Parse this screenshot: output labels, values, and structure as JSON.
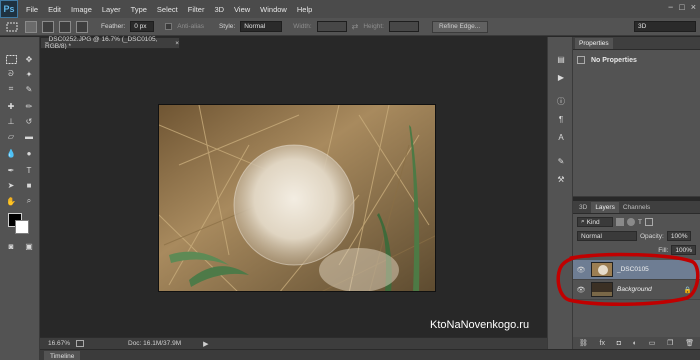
{
  "app": {
    "logo": "Ps"
  },
  "menu": [
    "File",
    "Edit",
    "Image",
    "Layer",
    "Type",
    "Select",
    "Filter",
    "3D",
    "View",
    "Window",
    "Help"
  ],
  "window_controls": [
    "−",
    "□",
    "×"
  ],
  "options": {
    "feather_label": "Feather:",
    "feather_value": "0 px",
    "antialias_label": "Anti-alias",
    "style_label": "Style:",
    "style_value": "Normal",
    "width_label": "Width:",
    "height_label": "Height:",
    "refine_edge": "Refine Edge...",
    "workspace": "3D"
  },
  "document": {
    "tab_title": "_DSC0252.JPG @ 16.7% (_DSC0105, RGB/8) *",
    "zoom": "16.67%",
    "doc_size": "Doc: 16.1M/37.9M"
  },
  "timeline": {
    "label": "Timeline"
  },
  "properties": {
    "tab": "Properties",
    "body": "No Properties"
  },
  "layers_panel": {
    "tabs": [
      "3D",
      "Layers",
      "Channels"
    ],
    "active_tab": "Layers",
    "kind": "Kind",
    "blend_mode": "Normal",
    "opacity_label": "Opacity:",
    "opacity_value": "100%",
    "fill_label": "Fill:",
    "fill_value": "100%",
    "layers": [
      {
        "name": "_DSC0105",
        "selected": true
      },
      {
        "name": "Background",
        "selected": false,
        "locked": true
      }
    ]
  },
  "watermark": "KtoNaNovenkogo.ru",
  "colors": {
    "menubar": "#4b4b4b",
    "panel": "#535353",
    "canvas_bg": "#282828",
    "selection": "#6e7d93",
    "annotation": "#c00000",
    "ps_blue": "#5fb4e6"
  },
  "icons": {
    "foreground_color": "black-swatch",
    "background_color": "white-swatch"
  }
}
